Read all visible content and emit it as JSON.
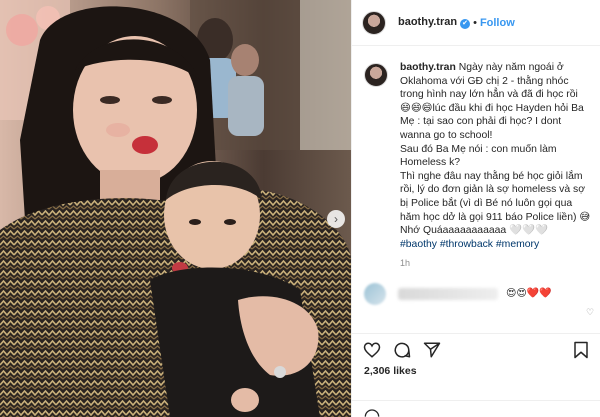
{
  "header": {
    "username": "baothy.tran",
    "verified_badge": "✔",
    "separator": "•",
    "follow_label": "Follow"
  },
  "caption": {
    "username": "baothy.tran",
    "lines": [
      "Ngày này năm ngoái ở",
      "Oklahoma với GĐ chị 2 - thằng nhóc",
      "trong hình nay lớn hẳn và đã đi học rồi",
      "😄😄😄lúc đầu khi đi học Hayden hỏi Ba",
      "Mẹ : tại sao con phải đi học? I dont",
      "wanna go to school!",
      "Sau đó Ba Mẹ nói : con muốn làm",
      "Homeless k?",
      "Thì nghe đâu nay thằng bé học giỏi lắm",
      "rồi, lý do đơn giản là sợ homeless và sợ",
      "bị Police bắt (vì dì Bé nó luôn gọi qua",
      "hăm học dở là gọi 911 báo Police liền) 😅",
      "Nhớ Quáaaaaaaaaaaa 🤍🤍🤍"
    ],
    "hashtags": "#baothy #throwback #memory",
    "time": "1h"
  },
  "comment": {
    "emoji": "😍😍❤️❤️"
  },
  "icons": {
    "heart": "heart-icon",
    "comment": "comment-icon",
    "share": "share-icon",
    "bookmark": "bookmark-icon",
    "next": "chevron-right-icon"
  },
  "stats": {
    "likes": "2,306 likes"
  },
  "colors": {
    "accent": "#3897f0",
    "text": "#262626",
    "muted": "#8e8e8e",
    "hashtag": "#00376b"
  }
}
